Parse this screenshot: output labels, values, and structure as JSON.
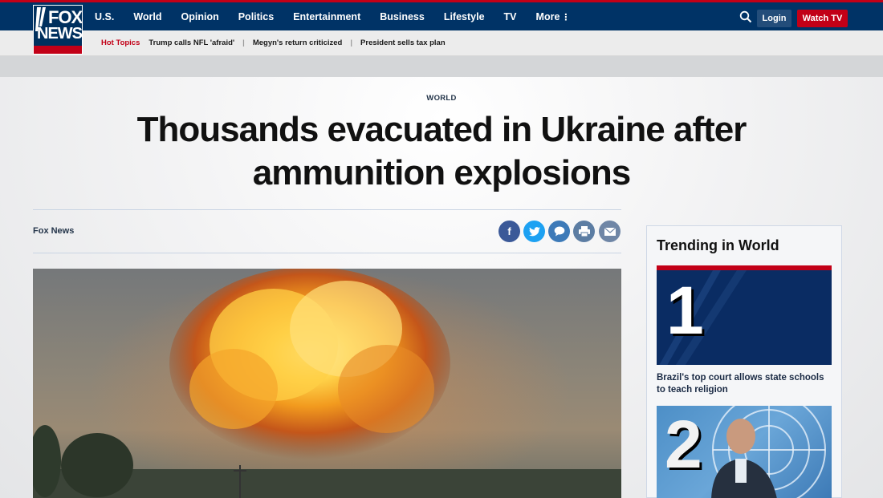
{
  "brand": {
    "logo_line1": "FOX",
    "logo_line2": "NEWS"
  },
  "nav": {
    "items": [
      "U.S.",
      "World",
      "Opinion",
      "Politics",
      "Entertainment",
      "Business",
      "Lifestyle",
      "TV"
    ],
    "more_label": "More",
    "more_icon": "⋮",
    "login_label": "Login",
    "watch_label": "Watch TV"
  },
  "hot_topics": {
    "label": "Hot Topics",
    "links": [
      "Trump calls NFL 'afraid'",
      "Megyn's return criticized",
      "President sells tax plan"
    ]
  },
  "article": {
    "category": "WORLD",
    "headline": "Thousands evacuated in Ukraine after ammunition explosions",
    "byline": "Fox News",
    "share": {
      "facebook": "f",
      "twitter": "t",
      "comments": "comments-icon",
      "print": "print-icon",
      "email": "email-icon"
    }
  },
  "sidebar": {
    "title": "Trending in World",
    "items": [
      {
        "rank": "1",
        "text": "Brazil's top court allows state schools to teach religion"
      },
      {
        "rank": "2",
        "text": ""
      }
    ]
  },
  "colors": {
    "nav_bg": "#003366",
    "brand_red": "#c20017",
    "login_bg": "#234d7a"
  }
}
